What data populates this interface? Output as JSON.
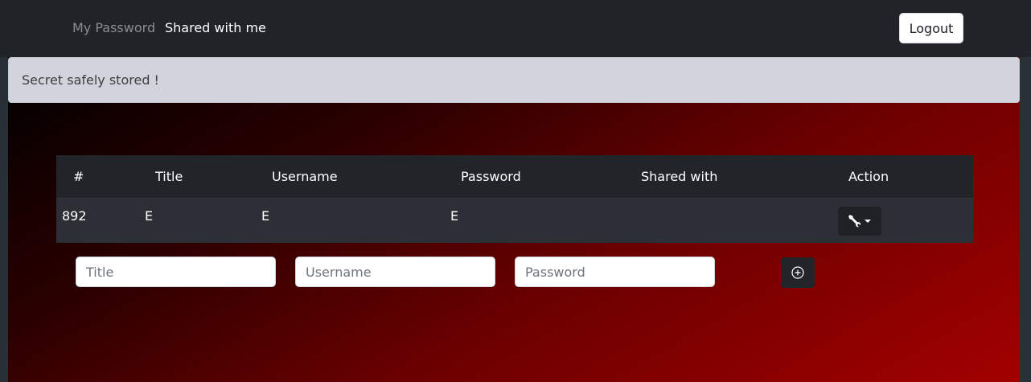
{
  "nav": {
    "my_password": "My Password",
    "shared_with_me": "Shared with me",
    "logout": "Logout"
  },
  "alert": {
    "message": "Secret safely stored !"
  },
  "table": {
    "headers": [
      "#",
      "Title",
      "Username",
      "Password",
      "Shared with",
      "Action"
    ],
    "rows": [
      {
        "id": "892",
        "title": "E",
        "username": "E",
        "password": "E",
        "shared_with": ""
      }
    ]
  },
  "form": {
    "title_placeholder": "Title",
    "username_placeholder": "Username",
    "password_placeholder": "Password"
  },
  "icons": {
    "action": "wrench-icon",
    "add": "plus-circle-icon"
  },
  "colors": {
    "navbar_bg": "#202328",
    "alert_bg": "#d1d4da",
    "gradient_dark": "#000000",
    "gradient_red": "#a30000"
  }
}
